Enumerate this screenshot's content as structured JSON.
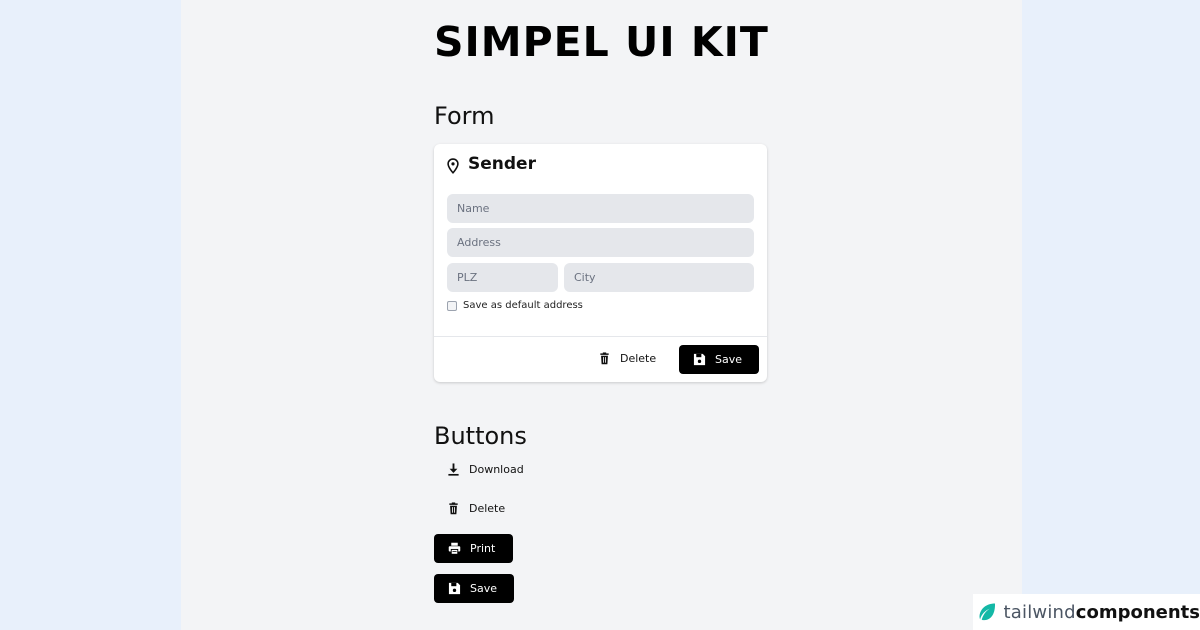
{
  "header": {
    "title": "SIMPEL UI KIT"
  },
  "form_section": {
    "title": "Form",
    "card": {
      "title": "Sender",
      "icon": "map-pin-icon",
      "fields": {
        "name_placeholder": "Name",
        "address_placeholder": "Address",
        "plz_placeholder": "PLZ",
        "city_placeholder": "City"
      },
      "checkbox_label": "Save as default address",
      "checkbox_checked": false,
      "actions": {
        "delete_label": "Delete",
        "delete_icon": "trash-icon",
        "save_label": "Save",
        "save_icon": "floppy-disk-icon"
      }
    }
  },
  "buttons_section": {
    "title": "Buttons",
    "download_label": "Download",
    "download_icon": "download-icon",
    "delete_label": "Delete",
    "delete_icon": "trash-icon",
    "print_label": "Print",
    "print_icon": "printer-icon",
    "save_label": "Save",
    "save_icon": "floppy-disk-icon"
  },
  "branding": {
    "logo_word_light": "tailwind",
    "logo_word_bold": "components",
    "logo_icon": "leaf-icon",
    "logo_color": "#14b8a6"
  },
  "colors": {
    "page_background": "#f3f4f6",
    "outer_background": "#e8f0fb",
    "input_background": "#e5e7eb",
    "primary_button": "#000000"
  }
}
